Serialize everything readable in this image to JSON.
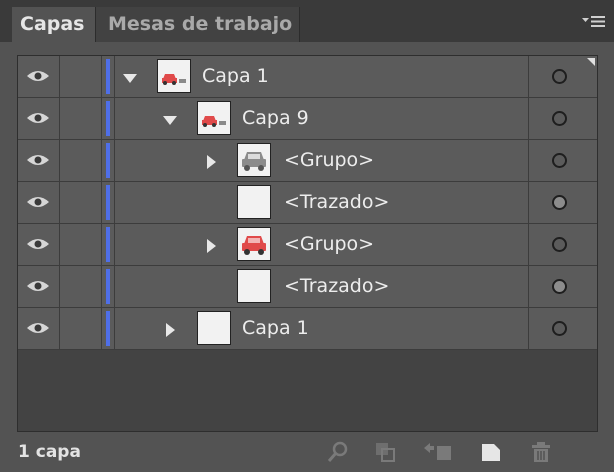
{
  "tabs": [
    {
      "label": "Capas",
      "active": true
    },
    {
      "label": "Mesas de trabajo",
      "active": false
    }
  ],
  "layers": [
    {
      "name": "Capa 1",
      "depth": 0,
      "arrow": "down",
      "thumb": "car-mixed",
      "target_filled": false
    },
    {
      "name": "Capa 9",
      "depth": 1,
      "arrow": "down",
      "thumb": "car-mixed",
      "target_filled": false
    },
    {
      "name": "<Grupo>",
      "depth": 2,
      "arrow": "right",
      "thumb": "car-gray",
      "target_filled": false
    },
    {
      "name": "<Trazado>",
      "depth": 2,
      "arrow": "none",
      "thumb": "blank",
      "target_filled": true
    },
    {
      "name": "<Grupo>",
      "depth": 2,
      "arrow": "right",
      "thumb": "car-red",
      "target_filled": false
    },
    {
      "name": "<Trazado>",
      "depth": 2,
      "arrow": "none",
      "thumb": "blank",
      "target_filled": true
    },
    {
      "name": "Capa 1",
      "depth": 1,
      "arrow": "right",
      "thumb": "blank",
      "target_filled": false
    }
  ],
  "footer": {
    "count_label": "1 capa"
  },
  "colors": {
    "layer_color": "#4f6fe8",
    "panel_bg": "#535353",
    "tab_bar_bg": "#3a3a3a"
  },
  "icons": {
    "panel_menu": "panel-menu-icon",
    "visibility": "eye-icon",
    "footer": [
      "search-icon",
      "clipping-mask-icon",
      "move-to-layer-icon",
      "new-layer-icon",
      "trash-icon"
    ]
  }
}
